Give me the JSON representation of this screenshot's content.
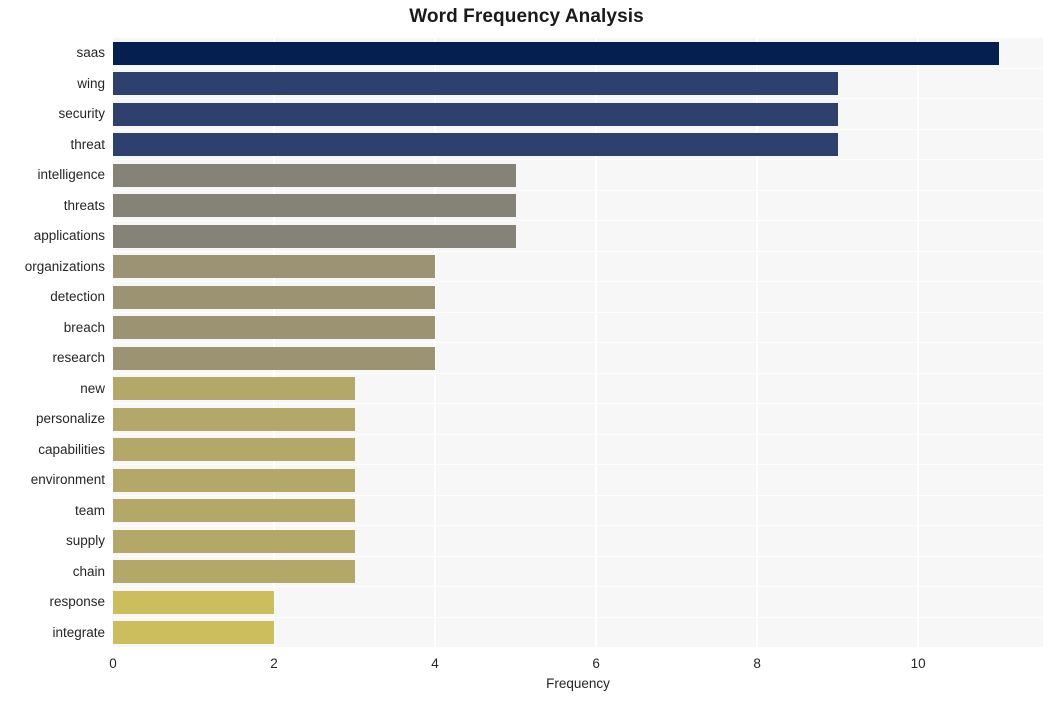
{
  "chart_data": {
    "type": "bar",
    "orientation": "horizontal",
    "title": "Word Frequency Analysis",
    "xlabel": "Frequency",
    "ylabel": "",
    "xlim": [
      0,
      11.55
    ],
    "xticks": [
      0,
      2,
      4,
      6,
      8,
      10
    ],
    "xticklabels": [
      "0",
      "2",
      "4",
      "6",
      "8",
      "10"
    ],
    "grid": "vertical",
    "legend": "none",
    "categories": [
      "saas",
      "wing",
      "security",
      "threat",
      "intelligence",
      "threats",
      "applications",
      "organizations",
      "detection",
      "breach",
      "research",
      "new",
      "personalize",
      "capabilities",
      "environment",
      "team",
      "supply",
      "chain",
      "response",
      "integrate"
    ],
    "values": [
      11,
      9,
      9,
      9,
      5,
      5,
      5,
      4,
      4,
      4,
      4,
      3,
      3,
      3,
      3,
      3,
      3,
      3,
      2,
      2
    ],
    "bar_colors": [
      "#042050",
      "#2e406e",
      "#2e406e",
      "#2e406e",
      "#858377",
      "#858377",
      "#858377",
      "#9c9372",
      "#9c9372",
      "#9c9372",
      "#9c9372",
      "#b3a867",
      "#b3a867",
      "#b3a867",
      "#b3a867",
      "#b3a867",
      "#b3a867",
      "#b3a867",
      "#ccbe5c",
      "#ccbe5c"
    ],
    "plot_background": "#f7f7f7",
    "figure_background": "#ffffff",
    "gridline_color": "#ffffff",
    "text_color": "#262626",
    "title_color": "#1a1a1a"
  }
}
